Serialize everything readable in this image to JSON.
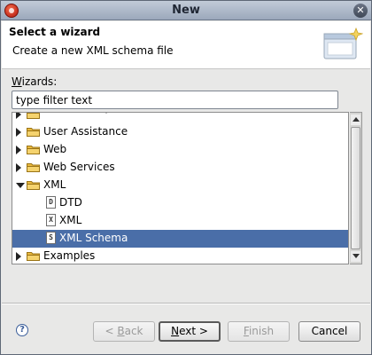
{
  "window": {
    "title": "New"
  },
  "header": {
    "title": "Select a wizard",
    "description": "Create a new XML schema file"
  },
  "wizards_label": {
    "mnemonic": "W",
    "rest": "izards:"
  },
  "filter": {
    "value": "type filter text"
  },
  "tree": {
    "items": [
      {
        "label": "SQL Development",
        "kind": "folder",
        "state": "closed",
        "indent": 0,
        "partial": true
      },
      {
        "label": "User Assistance",
        "kind": "folder",
        "state": "closed",
        "indent": 0
      },
      {
        "label": "Web",
        "kind": "folder",
        "state": "closed",
        "indent": 0
      },
      {
        "label": "Web Services",
        "kind": "folder",
        "state": "closed",
        "indent": 0
      },
      {
        "label": "XML",
        "kind": "folder",
        "state": "open",
        "indent": 0
      },
      {
        "label": "DTD",
        "kind": "file",
        "glyph": "D",
        "indent": 1
      },
      {
        "label": "XML",
        "kind": "file",
        "glyph": "X",
        "indent": 1
      },
      {
        "label": "XML Schema",
        "kind": "file",
        "glyph": "S",
        "indent": 1,
        "selected": true
      },
      {
        "label": "Examples",
        "kind": "folder",
        "state": "closed",
        "indent": 0
      }
    ]
  },
  "buttons": {
    "back": {
      "mnemonic": "B",
      "prefix": "< ",
      "rest": "ack"
    },
    "next": {
      "mnemonic": "N",
      "rest": "ext >"
    },
    "finish": {
      "mnemonic": "F",
      "rest": "inish"
    },
    "cancel": "Cancel",
    "help": "?"
  },
  "colors": {
    "selection": "#4a6ea8",
    "folder": "#f2c14e"
  }
}
